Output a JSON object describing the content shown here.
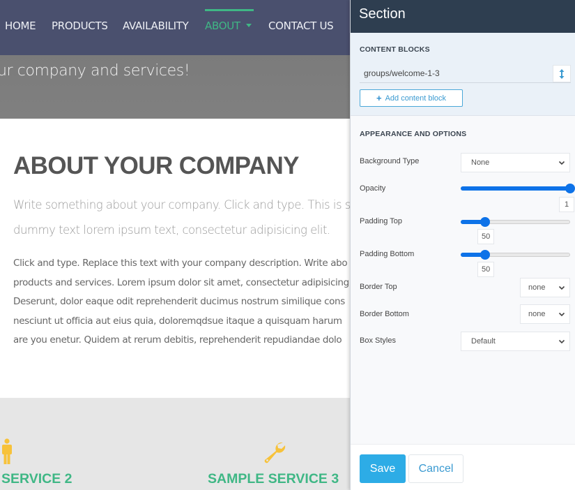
{
  "page": {
    "nav": {
      "items": [
        {
          "label": "HOME",
          "active": false
        },
        {
          "label": "PRODUCTS",
          "active": false
        },
        {
          "label": "AVAILABILITY",
          "active": false
        },
        {
          "label": "ABOUT",
          "active": true,
          "has_dropdown": true
        },
        {
          "label": "CONTACT US",
          "active": false
        }
      ],
      "accent_color": "#3fb785",
      "background": "#4a506e"
    },
    "hero": {
      "text": "ur company and services!"
    },
    "about": {
      "title": "ABOUT YOUR COMPANY",
      "lead_lines": [
        "Write something about your company. Click and type. This is s",
        "dummy text lorem ipsum text, consectetur adipisicing elit."
      ],
      "body_lines": [
        "Click and type. Replace this text with your company description. Write abo",
        "products and services. Lorem ipsum dolor sit amet, consectetur adipisicing",
        "Deserunt, dolor eaque odit reprehenderit ducimus nostrum similique cons",
        "nesciunt ut officia aut eius quia, doloremqdsue itaque a quisquam harum",
        "are you enetur. Quidem at rerum debitis, reprehenderit repudiandae dolo"
      ]
    },
    "services": [
      {
        "title": "SERVICE 2",
        "icon": "person-icon"
      },
      {
        "title": "SAMPLE SERVICE 3",
        "icon": "wrench-icon"
      }
    ],
    "service_icon_color": "#f7c23a"
  },
  "panel": {
    "title": "Section",
    "content_blocks": {
      "label": "CONTENT BLOCKS",
      "items": [
        "groups/welcome-1-3"
      ],
      "add_label": "Add content block"
    },
    "appearance": {
      "label": "APPEARANCE AND OPTIONS",
      "background_type": {
        "label": "Background Type",
        "value": "None"
      },
      "opacity": {
        "label": "Opacity",
        "value": "1",
        "fraction": 1.0
      },
      "padding_top": {
        "label": "Padding Top",
        "value": "50",
        "fraction": 0.22
      },
      "padding_bottom": {
        "label": "Padding Bottom",
        "value": "50",
        "fraction": 0.22
      },
      "border_top": {
        "label": "Border Top",
        "value": "none"
      },
      "border_bottom": {
        "label": "Border Bottom",
        "value": "none"
      },
      "box_styles": {
        "label": "Box Styles",
        "value": "Default"
      }
    },
    "footer": {
      "save_label": "Save",
      "cancel_label": "Cancel"
    },
    "colors": {
      "header": "#2e3e50",
      "primary": "#2dace6",
      "slider": "#0d72e8"
    }
  }
}
